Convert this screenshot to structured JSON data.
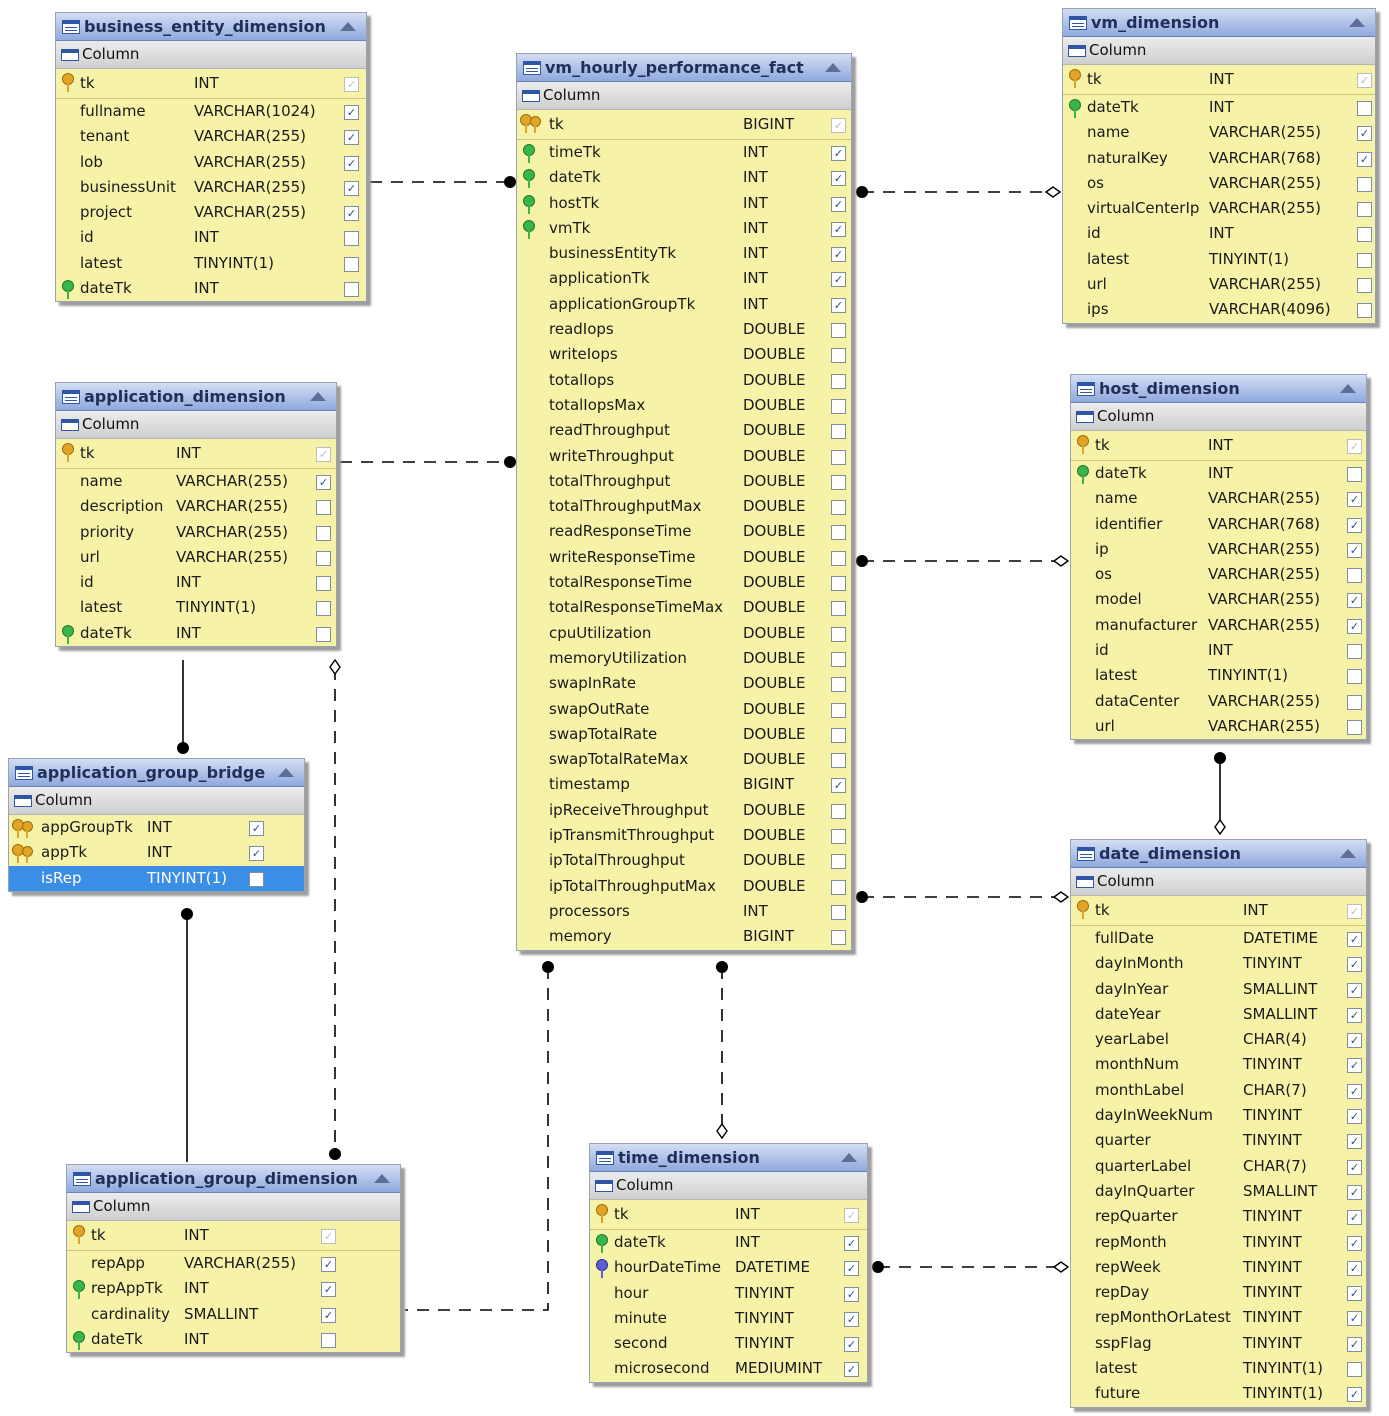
{
  "column_header": "Column",
  "tables": [
    {
      "id": "business_entity_dimension",
      "name": "business_entity_dimension",
      "columns": [
        {
          "name": "tk",
          "type": "INT",
          "key": "pk",
          "checked": true
        },
        {
          "name": "fullname",
          "type": "VARCHAR(1024)",
          "checked": true
        },
        {
          "name": "tenant",
          "type": "VARCHAR(255)",
          "checked": true
        },
        {
          "name": "lob",
          "type": "VARCHAR(255)",
          "checked": true
        },
        {
          "name": "businessUnit",
          "type": "VARCHAR(255)",
          "checked": true
        },
        {
          "name": "project",
          "type": "VARCHAR(255)",
          "checked": true
        },
        {
          "name": "id",
          "type": "INT",
          "checked": false
        },
        {
          "name": "latest",
          "type": "TINYINT(1)",
          "checked": false
        },
        {
          "name": "dateTk",
          "type": "INT",
          "key": "fk",
          "checked": false
        }
      ]
    },
    {
      "id": "vm_hourly_performance_fact",
      "name": "vm_hourly_performance_fact",
      "columns": [
        {
          "name": "tk",
          "type": "BIGINT",
          "key": "pk2",
          "checked": true
        },
        {
          "name": "timeTk",
          "type": "INT",
          "key": "fk",
          "checked": true
        },
        {
          "name": "dateTk",
          "type": "INT",
          "key": "fk",
          "checked": true
        },
        {
          "name": "hostTk",
          "type": "INT",
          "key": "fk",
          "checked": true
        },
        {
          "name": "vmTk",
          "type": "INT",
          "key": "fk",
          "checked": true
        },
        {
          "name": "businessEntityTk",
          "type": "INT",
          "checked": true
        },
        {
          "name": "applicationTk",
          "type": "INT",
          "checked": true
        },
        {
          "name": "applicationGroupTk",
          "type": "INT",
          "checked": true
        },
        {
          "name": "readIops",
          "type": "DOUBLE",
          "checked": false
        },
        {
          "name": "writeIops",
          "type": "DOUBLE",
          "checked": false
        },
        {
          "name": "totalIops",
          "type": "DOUBLE",
          "checked": false
        },
        {
          "name": "totalIopsMax",
          "type": "DOUBLE",
          "checked": false
        },
        {
          "name": "readThroughput",
          "type": "DOUBLE",
          "checked": false
        },
        {
          "name": "writeThroughput",
          "type": "DOUBLE",
          "checked": false
        },
        {
          "name": "totalThroughput",
          "type": "DOUBLE",
          "checked": false
        },
        {
          "name": "totalThroughputMax",
          "type": "DOUBLE",
          "checked": false
        },
        {
          "name": "readResponseTime",
          "type": "DOUBLE",
          "checked": false
        },
        {
          "name": "writeResponseTime",
          "type": "DOUBLE",
          "checked": false
        },
        {
          "name": "totalResponseTime",
          "type": "DOUBLE",
          "checked": false
        },
        {
          "name": "totalResponseTimeMax",
          "type": "DOUBLE",
          "checked": false
        },
        {
          "name": "cpuUtilization",
          "type": "DOUBLE",
          "checked": false
        },
        {
          "name": "memoryUtilization",
          "type": "DOUBLE",
          "checked": false
        },
        {
          "name": "swapInRate",
          "type": "DOUBLE",
          "checked": false
        },
        {
          "name": "swapOutRate",
          "type": "DOUBLE",
          "checked": false
        },
        {
          "name": "swapTotalRate",
          "type": "DOUBLE",
          "checked": false
        },
        {
          "name": "swapTotalRateMax",
          "type": "DOUBLE",
          "checked": false
        },
        {
          "name": "timestamp",
          "type": "BIGINT",
          "checked": true
        },
        {
          "name": "ipReceiveThroughput",
          "type": "DOUBLE",
          "checked": false
        },
        {
          "name": "ipTransmitThroughput",
          "type": "DOUBLE",
          "checked": false
        },
        {
          "name": "ipTotalThroughput",
          "type": "DOUBLE",
          "checked": false
        },
        {
          "name": "ipTotalThroughputMax",
          "type": "DOUBLE",
          "checked": false
        },
        {
          "name": "processors",
          "type": "INT",
          "checked": false
        },
        {
          "name": "memory",
          "type": "BIGINT",
          "checked": false
        }
      ]
    },
    {
      "id": "vm_dimension",
      "name": "vm_dimension",
      "columns": [
        {
          "name": "tk",
          "type": "INT",
          "key": "pk",
          "checked": true
        },
        {
          "name": "dateTk",
          "type": "INT",
          "key": "fk",
          "checked": false
        },
        {
          "name": "name",
          "type": "VARCHAR(255)",
          "checked": true
        },
        {
          "name": "naturalKey",
          "type": "VARCHAR(768)",
          "checked": true
        },
        {
          "name": "os",
          "type": "VARCHAR(255)",
          "checked": false
        },
        {
          "name": "virtualCenterIp",
          "type": "VARCHAR(255)",
          "checked": false
        },
        {
          "name": "id",
          "type": "INT",
          "checked": false
        },
        {
          "name": "latest",
          "type": "TINYINT(1)",
          "checked": false
        },
        {
          "name": "url",
          "type": "VARCHAR(255)",
          "checked": false
        },
        {
          "name": "ips",
          "type": "VARCHAR(4096)",
          "checked": false
        }
      ]
    },
    {
      "id": "application_dimension",
      "name": "application_dimension",
      "columns": [
        {
          "name": "tk",
          "type": "INT",
          "key": "pk",
          "checked": true
        },
        {
          "name": "name",
          "type": "VARCHAR(255)",
          "checked": true
        },
        {
          "name": "description",
          "type": "VARCHAR(255)",
          "checked": false
        },
        {
          "name": "priority",
          "type": "VARCHAR(255)",
          "checked": false
        },
        {
          "name": "url",
          "type": "VARCHAR(255)",
          "checked": false
        },
        {
          "name": "id",
          "type": "INT",
          "checked": false
        },
        {
          "name": "latest",
          "type": "TINYINT(1)",
          "checked": false
        },
        {
          "name": "dateTk",
          "type": "INT",
          "key": "fk",
          "checked": false
        }
      ]
    },
    {
      "id": "host_dimension",
      "name": "host_dimension",
      "columns": [
        {
          "name": "tk",
          "type": "INT",
          "key": "pk",
          "checked": true
        },
        {
          "name": "dateTk",
          "type": "INT",
          "key": "fk",
          "checked": false
        },
        {
          "name": "name",
          "type": "VARCHAR(255)",
          "checked": true
        },
        {
          "name": "identifier",
          "type": "VARCHAR(768)",
          "checked": true
        },
        {
          "name": "ip",
          "type": "VARCHAR(255)",
          "checked": true
        },
        {
          "name": "os",
          "type": "VARCHAR(255)",
          "checked": false
        },
        {
          "name": "model",
          "type": "VARCHAR(255)",
          "checked": true
        },
        {
          "name": "manufacturer",
          "type": "VARCHAR(255)",
          "checked": true
        },
        {
          "name": "id",
          "type": "INT",
          "checked": false
        },
        {
          "name": "latest",
          "type": "TINYINT(1)",
          "checked": false
        },
        {
          "name": "dataCenter",
          "type": "VARCHAR(255)",
          "checked": false
        },
        {
          "name": "url",
          "type": "VARCHAR(255)",
          "checked": false
        }
      ]
    },
    {
      "id": "application_group_bridge",
      "name": "application_group_bridge",
      "columns": [
        {
          "name": "appGroupTk",
          "type": "INT",
          "key": "pk2",
          "checked": true
        },
        {
          "name": "appTk",
          "type": "INT",
          "key": "pk2",
          "checked": true
        },
        {
          "name": "isRep",
          "type": "TINYINT(1)",
          "checked": false,
          "selected": true
        }
      ]
    },
    {
      "id": "date_dimension",
      "name": "date_dimension",
      "columns": [
        {
          "name": "tk",
          "type": "INT",
          "key": "pk",
          "checked": true
        },
        {
          "name": "fullDate",
          "type": "DATETIME",
          "checked": true
        },
        {
          "name": "dayInMonth",
          "type": "TINYINT",
          "checked": true
        },
        {
          "name": "dayInYear",
          "type": "SMALLINT",
          "checked": true
        },
        {
          "name": "dateYear",
          "type": "SMALLINT",
          "checked": true
        },
        {
          "name": "yearLabel",
          "type": "CHAR(4)",
          "checked": true
        },
        {
          "name": "monthNum",
          "type": "TINYINT",
          "checked": true
        },
        {
          "name": "monthLabel",
          "type": "CHAR(7)",
          "checked": true
        },
        {
          "name": "dayInWeekNum",
          "type": "TINYINT",
          "checked": true
        },
        {
          "name": "quarter",
          "type": "TINYINT",
          "checked": true
        },
        {
          "name": "quarterLabel",
          "type": "CHAR(7)",
          "checked": true
        },
        {
          "name": "dayInQuarter",
          "type": "SMALLINT",
          "checked": true
        },
        {
          "name": "repQuarter",
          "type": "TINYINT",
          "checked": true
        },
        {
          "name": "repMonth",
          "type": "TINYINT",
          "checked": true
        },
        {
          "name": "repWeek",
          "type": "TINYINT",
          "checked": true
        },
        {
          "name": "repDay",
          "type": "TINYINT",
          "checked": true
        },
        {
          "name": "repMonthOrLatest",
          "type": "TINYINT",
          "checked": true
        },
        {
          "name": "sspFlag",
          "type": "TINYINT",
          "checked": true
        },
        {
          "name": "latest",
          "type": "TINYINT(1)",
          "checked": false
        },
        {
          "name": "future",
          "type": "TINYINT(1)",
          "checked": true
        }
      ]
    },
    {
      "id": "time_dimension",
      "name": "time_dimension",
      "columns": [
        {
          "name": "tk",
          "type": "INT",
          "key": "pk",
          "checked": true
        },
        {
          "name": "dateTk",
          "type": "INT",
          "key": "fk",
          "checked": true
        },
        {
          "name": "hourDateTime",
          "type": "DATETIME",
          "key": "fk2",
          "checked": true
        },
        {
          "name": "hour",
          "type": "TINYINT",
          "checked": true
        },
        {
          "name": "minute",
          "type": "TINYINT",
          "checked": true
        },
        {
          "name": "second",
          "type": "TINYINT",
          "checked": true
        },
        {
          "name": "microsecond",
          "type": "MEDIUMINT",
          "checked": true
        }
      ]
    },
    {
      "id": "application_group_dimension",
      "name": "application_group_dimension",
      "columns": [
        {
          "name": "tk",
          "type": "INT",
          "key": "pk",
          "checked": true
        },
        {
          "name": "repApp",
          "type": "VARCHAR(255)",
          "checked": true
        },
        {
          "name": "repAppTk",
          "type": "INT",
          "key": "fk",
          "checked": true
        },
        {
          "name": "cardinality",
          "type": "SMALLINT",
          "checked": true
        },
        {
          "name": "dateTk",
          "type": "INT",
          "key": "fk",
          "checked": false
        }
      ]
    }
  ],
  "relationships": [
    {
      "from": "business_entity_dimension",
      "to": "vm_hourly_performance_fact",
      "line": "dashed"
    },
    {
      "from": "application_dimension",
      "to": "vm_hourly_performance_fact",
      "line": "dashed"
    },
    {
      "from": "vm_hourly_performance_fact",
      "to": "vm_dimension",
      "line": "dashed"
    },
    {
      "from": "vm_hourly_performance_fact",
      "to": "host_dimension",
      "line": "dashed"
    },
    {
      "from": "vm_hourly_performance_fact",
      "to": "date_dimension",
      "line": "dashed"
    },
    {
      "from": "host_dimension",
      "to": "date_dimension",
      "line": "solid"
    },
    {
      "from": "application_dimension",
      "to": "application_group_bridge",
      "line": "solid"
    },
    {
      "from": "application_group_bridge",
      "to": "application_group_dimension",
      "line": "solid"
    },
    {
      "from": "application_dimension",
      "to": "application_group_dimension",
      "line": "dashed"
    },
    {
      "from": "vm_hourly_performance_fact",
      "to": "time_dimension",
      "line": "dashed"
    },
    {
      "from": "vm_hourly_performance_fact",
      "to": "application_group_dimension",
      "line": "dashed"
    },
    {
      "from": "time_dimension",
      "to": "date_dimension",
      "line": "dashed"
    }
  ]
}
